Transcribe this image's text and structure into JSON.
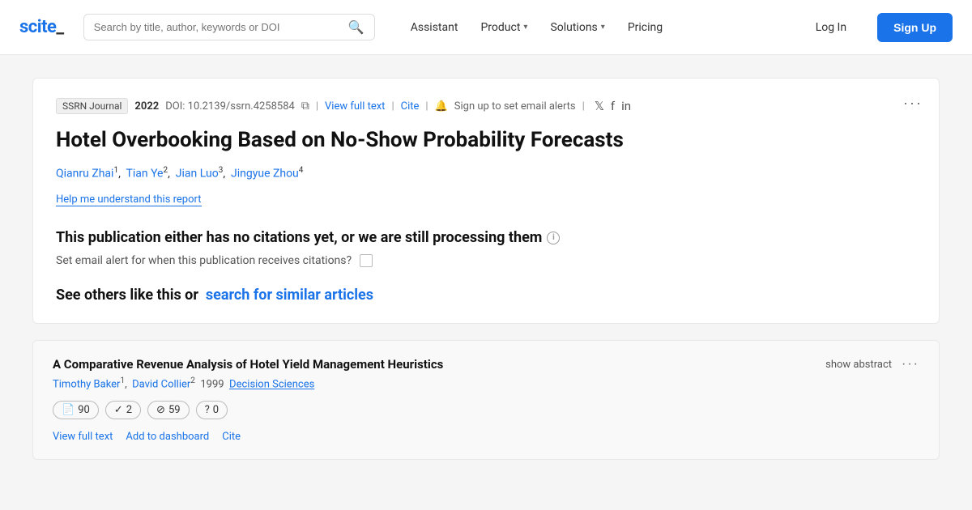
{
  "brand": {
    "logo_text": "scite_"
  },
  "navbar": {
    "search_placeholder": "Search by title, author, keywords or DOI",
    "assistant_label": "Assistant",
    "product_label": "Product",
    "solutions_label": "Solutions",
    "pricing_label": "Pricing",
    "login_label": "Log In",
    "signup_label": "Sign Up"
  },
  "article": {
    "journal": "SSRN Journal",
    "year": "2022",
    "doi": "DOI: 10.2139/ssrn.4258584",
    "view_full_text": "View full text",
    "cite": "Cite",
    "alert_text": "Sign up to set email alerts",
    "title": "Hotel Overbooking Based on No-Show Probability Forecasts",
    "authors": [
      {
        "name": "Qianru Zhai",
        "sup": "1"
      },
      {
        "name": "Tian Ye",
        "sup": "2"
      },
      {
        "name": "Jian Luo",
        "sup": "3"
      },
      {
        "name": "Jingyue Zhou",
        "sup": "4"
      }
    ],
    "help_link": "Help me understand this report",
    "no_citations_text": "This publication either has no citations yet, or we are still processing them",
    "email_alert_label": "Set email alert for when this publication receives citations?",
    "see_others_text": "See others like this or",
    "search_similar_link": "search for similar articles"
  },
  "related": {
    "title": "A Comparative Revenue Analysis of Hotel Yield Management Heuristics",
    "authors": "Timothy Baker",
    "author_sup": "1",
    "author2": "David Collier",
    "author2_sup": "2",
    "year": "1999",
    "journal": "Decision Sciences",
    "show_abstract": "show abstract",
    "badges": [
      {
        "icon": "📄",
        "value": "90"
      },
      {
        "icon": "✓",
        "value": "2"
      },
      {
        "icon": "⊘",
        "value": "59"
      },
      {
        "icon": "?",
        "value": "0"
      }
    ],
    "view_full_text": "View full text",
    "add_dashboard": "Add to dashboard",
    "cite": "Cite"
  }
}
